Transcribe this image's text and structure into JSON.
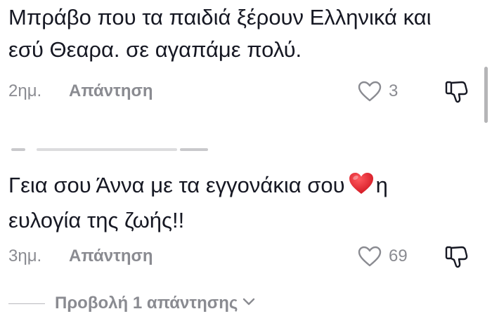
{
  "comments": [
    {
      "text_lines": [
        "Μπράβο που τα παιδιά ξέρουν Ελληνικά και",
        "εσύ Θεαρα. σε αγαπάμε πολύ."
      ],
      "time": "2ημ.",
      "reply_label": "Απάντηση",
      "like_count": "3"
    },
    {
      "text_line1_before": "Γεια σου Άννα με τα εγγονάκια σου",
      "text_emoji": "red-heart-emoji",
      "text_line1_after": "η",
      "text_line2": "ευλογία της ζωής!!",
      "time": "3ημ.",
      "reply_label": "Απάντηση",
      "like_count": "69"
    }
  ],
  "view_replies_label": "Προβολή 1 απάντησης",
  "colors": {
    "text": "#161823",
    "muted": "#8a8b91",
    "heart": "#e5202b"
  },
  "icons": {
    "like": "heart-outline-icon",
    "dislike": "thumbs-down-icon",
    "expand": "chevron-down-icon"
  }
}
